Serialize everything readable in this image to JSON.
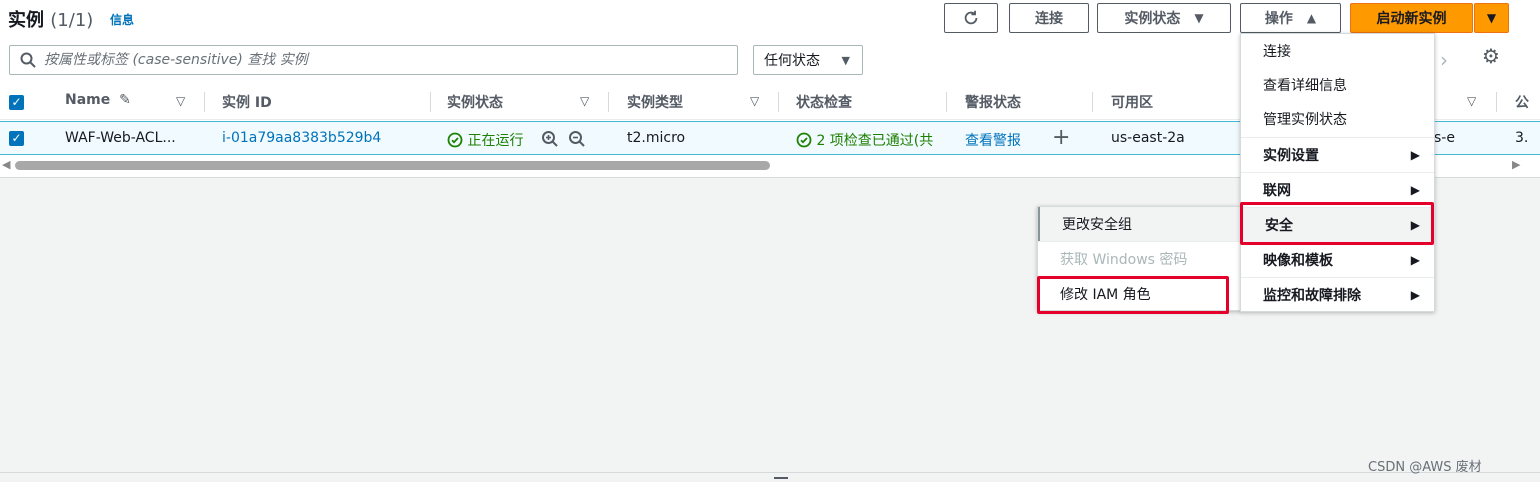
{
  "header": {
    "title": "实例",
    "count": "(1/1)",
    "info_link": "信息"
  },
  "toolbar": {
    "connect_label": "连接",
    "instance_state_label": "实例状态",
    "actions_label": "操作",
    "launch_label": "启动新实例"
  },
  "search": {
    "placeholder": "按属性或标签 (case-sensitive) 查找 实例"
  },
  "state_filter": {
    "selected": "任何状态"
  },
  "table": {
    "columns": [
      "Name",
      "实例 ID",
      "实例状态",
      "实例类型",
      "状态检查",
      "警报状态",
      "可用区",
      "公"
    ],
    "row": {
      "name": "WAF-Web-ACL...",
      "instance_id": "i-01a79aa8383b529b4",
      "state": "正在运行",
      "type": "t2.micro",
      "status_check": "2 项检查已通过(共",
      "alarm": "查看警报",
      "az": "us-east-2a",
      "dns_partial": "s-e",
      "ip_partial": "3."
    }
  },
  "actions_menu": {
    "items": [
      {
        "label": "连接"
      },
      {
        "label": "查看详细信息"
      },
      {
        "label": "管理实例状态"
      },
      {
        "label": "实例设置"
      },
      {
        "label": "联网"
      },
      {
        "label": "安全"
      },
      {
        "label": "映像和模板"
      },
      {
        "label": "监控和故障排除"
      }
    ]
  },
  "security_submenu": {
    "items": [
      {
        "label": "更改安全组"
      },
      {
        "label": "获取 Windows 密码"
      },
      {
        "label": "修改 IAM 角色"
      }
    ]
  },
  "watermark": "CSDN @AWS 废材",
  "colors": {
    "accent": "#0073bb",
    "primary_button": "#ff9900",
    "success": "#1d8102",
    "highlight_red": "#e4002b"
  }
}
